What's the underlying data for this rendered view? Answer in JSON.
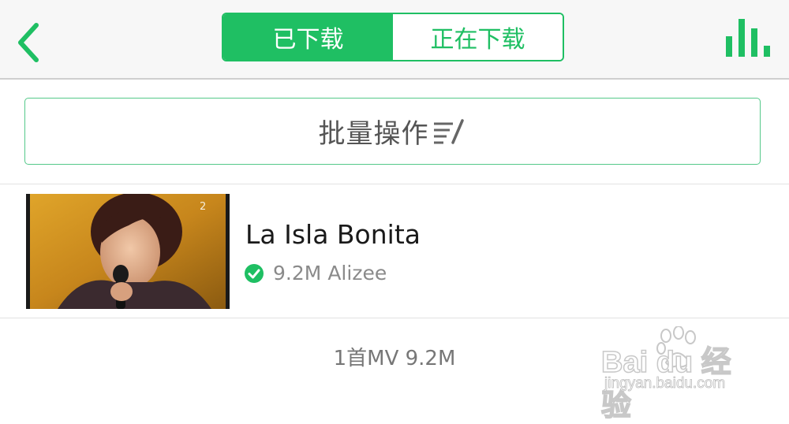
{
  "header": {
    "tabs": [
      {
        "label": "已下载",
        "active": true
      },
      {
        "label": "正在下载",
        "active": false
      }
    ],
    "back_icon": "chevron-left-icon",
    "menu_icon": "bars-icon"
  },
  "batch": {
    "label": "批量操作",
    "icon": "list-edit-icon"
  },
  "items": [
    {
      "title": "La Isla Bonita",
      "size": "9.2M",
      "artist": "Alizee",
      "status_icon": "check-circle-icon"
    }
  ],
  "footer": {
    "summary": "1首MV 9.2M"
  },
  "watermark": {
    "brand": "Bai du 经验",
    "site": "jingyan.baidu.com"
  },
  "colors": {
    "accent": "#1fbf63",
    "header_bg": "#f7f7f7",
    "text_primary": "#1a1a1a",
    "text_secondary": "#8a8a8a"
  }
}
